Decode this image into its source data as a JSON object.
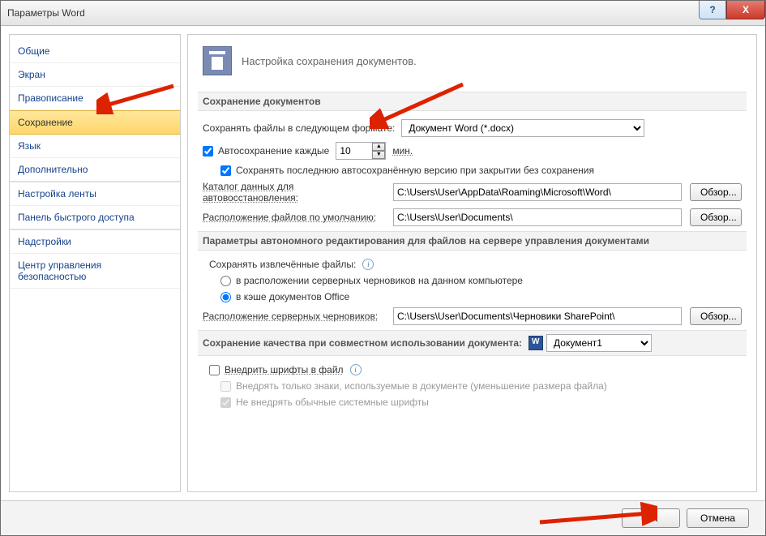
{
  "window": {
    "title": "Параметры Word"
  },
  "winbuttons": {
    "help": "?",
    "close": "X"
  },
  "sidebar": {
    "items": [
      {
        "label": "Общие"
      },
      {
        "label": "Экран"
      },
      {
        "label": "Правописание"
      },
      {
        "label": "Сохранение",
        "selected": true
      },
      {
        "label": "Язык"
      },
      {
        "label": "Дополнительно"
      },
      {
        "label": "Настройка ленты"
      },
      {
        "label": "Панель быстрого доступа"
      },
      {
        "label": "Надстройки"
      },
      {
        "label": "Центр управления безопасностью"
      }
    ]
  },
  "header": {
    "text": "Настройка сохранения документов."
  },
  "section1": {
    "title": "Сохранение документов",
    "format_label": "Сохранять файлы в следующем формате:",
    "format_value": "Документ Word (*.docx)",
    "autosave_label": "Автосохранение каждые",
    "autosave_value": "10",
    "autosave_unit": "мин.",
    "keep_last_label": "Сохранять последнюю автосохранённую версию при закрытии без сохранения",
    "autorecov_label": "Каталог данных для автовосстановления:",
    "autorecov_path": "C:\\Users\\User\\AppData\\Roaming\\Microsoft\\Word\\",
    "default_loc_label": "Расположение файлов по умолчанию:",
    "default_loc_path": "C:\\Users\\User\\Documents\\",
    "browse": "Обзор..."
  },
  "section2": {
    "title": "Параметры автономного редактирования для файлов на сервере управления документами",
    "extracted_label": "Сохранять извлечённые файлы:",
    "opt1": "в расположении серверных черновиков на данном компьютере",
    "opt2": "в кэше документов Office",
    "drafts_label": "Расположение серверных черновиков:",
    "drafts_path": "C:\\Users\\User\\Documents\\Черновики SharePoint\\",
    "browse": "Обзор..."
  },
  "section3": {
    "title": "Сохранение качества при совместном использовании документа:",
    "doc_name": " Документ1",
    "embed_label": "Внедрить шрифты в файл",
    "embed_sub1": "Внедрять только знаки, используемые в документе (уменьшение размера файла)",
    "embed_sub2": "Не внедрять обычные системные шрифты"
  },
  "footer": {
    "ok": "OK",
    "cancel": "Отмена"
  }
}
